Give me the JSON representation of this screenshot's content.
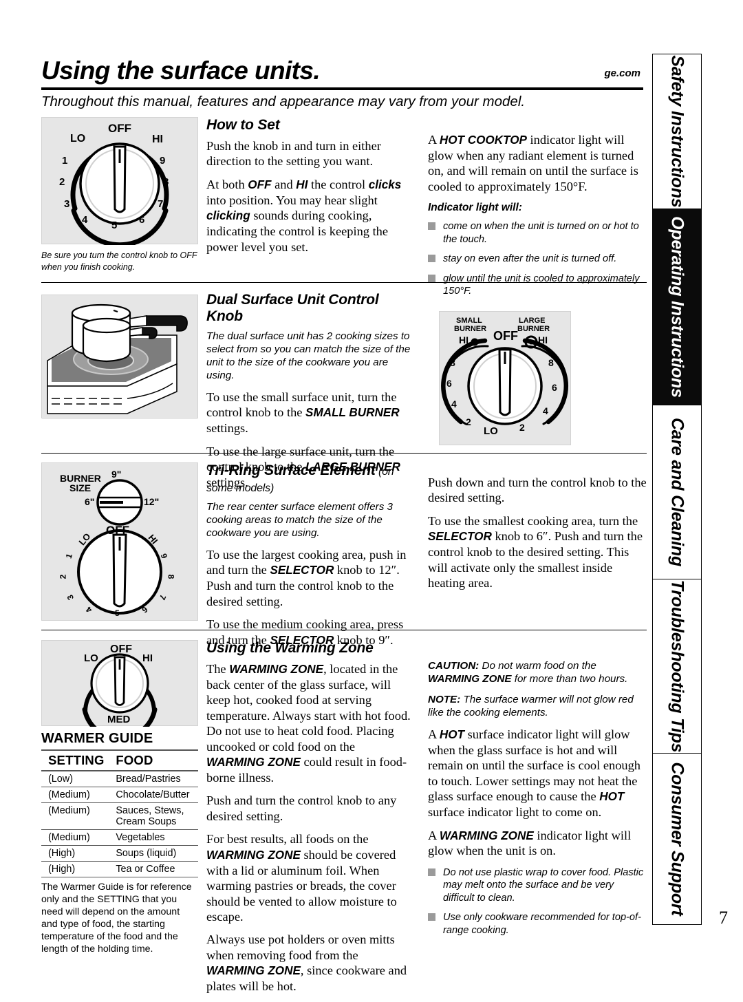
{
  "header": {
    "title": "Using the surface units.",
    "site": "ge.com",
    "subtitle": "Throughout this manual, features and appearance may vary from your model."
  },
  "sidebar": {
    "tabs": [
      {
        "label": "Safety Instructions",
        "active": false
      },
      {
        "label": "Operating Instructions",
        "active": true
      },
      {
        "label": "Care and Cleaning",
        "active": false
      },
      {
        "label": "Troubleshooting Tips",
        "active": false
      },
      {
        "label": "Consumer Support",
        "active": false
      }
    ]
  },
  "how_to_set": {
    "figure": {
      "off": "OFF",
      "lo": "LO",
      "hi": "HI",
      "numbers": [
        "1",
        "2",
        "3",
        "4",
        "5",
        "6",
        "7",
        "8",
        "9"
      ],
      "caption": "Be sure you turn the control knob to OFF when you finish cooking."
    },
    "heading": "How to Set",
    "p1": "Push the knob in and turn in either direction to the setting you want.",
    "p2_a": "At both ",
    "p2_off": "OFF",
    "p2_b": " and ",
    "p2_hi": "HI",
    "p2_c": " the control ",
    "p2_clicks": "clicks",
    "p2_d": " into position. You may hear slight ",
    "p2_clicking": "clicking",
    "p2_e": " sounds during cooking, indicating the control is keeping the power level you set.",
    "r1_a": "A ",
    "r1_hot": "HOT COOKTOP",
    "r1_b": " indicator light will glow when any radiant element is turned on, and will remain on until the surface is cooled to approximately 150°F.",
    "indicator_heading": "Indicator light will:",
    "bullets": [
      "come on when the unit is turned on or hot to the touch.",
      "stay on even after the unit is turned off.",
      "glow until the unit is cooled to approximately 150°F."
    ]
  },
  "dual_unit": {
    "heading": "Dual Surface Unit Control Knob",
    "p1": "The dual surface unit has 2 cooking sizes to select from so you can match the size of the unit to the size of the cookware you are using.",
    "p2_a": "To use the small surface unit, turn the control knob to the  ",
    "p2_small": "SMALL BURNER",
    "p2_b": " settings.",
    "p3_a": "To use the large surface unit, turn the control knob to the  ",
    "p3_large": "LARGE BURNER",
    "p3_b": " settings.",
    "figure": {
      "small_burner": "SMALL\nBURNER",
      "small_burner_l1": "SMALL",
      "small_burner_l2": "BURNER",
      "large_burner_l1": "LARGE",
      "large_burner_l2": "BURNER",
      "off": "OFF",
      "lo": "LO",
      "hi_left": "HI",
      "hi_right": "HI",
      "left_numbers": [
        "8",
        "6",
        "4",
        "2"
      ],
      "right_numbers": [
        "8",
        "6",
        "4",
        "2"
      ]
    }
  },
  "tri_ring": {
    "heading": "Tri-Ring Surface Element",
    "heading_note": "(on some models)",
    "p1": "The rear center surface element offers 3 cooking areas to match the size of the cookware you are using.",
    "p2_a": "To use the largest cooking area, push in and turn the ",
    "p2_sel": "SELECTOR",
    "p2_b": " knob to 12″. Push and turn the control knob to the desired setting.",
    "p3_a": "To use the medium cooking area, press and turn the ",
    "p3_sel": "SELECTOR",
    "p3_b": " knob to 9″.",
    "r1": "Push down and turn the control knob to the desired setting.",
    "r2_a": "To use the smallest cooking area, turn the ",
    "r2_sel": "SELECTOR",
    "r2_b": " knob to 6″. Push and turn the control knob to the desired setting. This will activate only the smallest inside heating area.",
    "figure": {
      "burner_size_l1": "BURNER",
      "burner_size_l2": "SIZE",
      "size_9": "9\"",
      "size_6": "6\"",
      "size_12": "12\"",
      "off": "OFF",
      "lo": "LO",
      "hi": "HI",
      "numbers": [
        "1",
        "2",
        "3",
        "4",
        "5",
        "6",
        "7",
        "8",
        "9"
      ]
    }
  },
  "warming_zone": {
    "heading": "Using the Warming Zone",
    "p1_a": "The ",
    "p1_wz": "WARMING ZONE",
    "p1_b": ", located in the back center of the glass surface, will keep hot, cooked food at serving temperature. Always start with hot food. Do not use to heat cold food. Placing uncooked or cold food on the ",
    "p1_wz2": "WARMING ZONE",
    "p1_c": " could result in food-borne illness.",
    "p2": "Push and turn the control knob to any desired setting.",
    "p3_a": "For best results, all foods on the ",
    "p3_wz": "WARMING ZONE",
    "p3_b": " should be covered with a lid or aluminum foil. When warming pastries or breads, the cover should be vented to allow moisture to escape.",
    "p4_a": "Always use pot holders or oven mitts when removing food from the ",
    "p4_wz": "WARMING ZONE",
    "p4_b": ", since cookware and plates will be hot.",
    "caution_label": "CAUTION:",
    "caution_a": " Do not warm food on the ",
    "caution_wz": "WARMING ZONE",
    "caution_b": " for more than two hours.",
    "note_label": "NOTE:",
    "note_text": " The surface warmer will not glow red like the cooking elements.",
    "r2_a": "A ",
    "r2_hot": "HOT",
    "r2_b": " surface indicator light will glow when the glass surface is hot and will remain on until the surface is cool enough to touch. Lower settings may not heat the glass surface enough to cause the ",
    "r2_hot2": "HOT",
    "r2_c": " surface indicator light to come on.",
    "r3_a": "A ",
    "r3_wz": "WARMING ZONE",
    "r3_b": " indicator light will glow when the unit is on.",
    "bullets": [
      "Do not use plastic wrap to cover food. Plastic may melt onto the surface and be very difficult to clean.",
      "Use only cookware recommended for top-of-range cooking."
    ],
    "figure": {
      "off": "OFF",
      "lo": "LO",
      "hi": "HI",
      "med": "MED"
    }
  },
  "warmer_guide": {
    "title": "WARMER GUIDE",
    "columns": [
      "SETTING",
      "FOOD"
    ],
    "rows": [
      {
        "setting": "(Low)",
        "food": "Bread/Pastries"
      },
      {
        "setting": "(Medium)",
        "food": "Chocolate/Butter"
      },
      {
        "setting": "(Medium)",
        "food": "Sauces, Stews,\nCream Soups"
      },
      {
        "setting": "(Medium)",
        "food": "Vegetables"
      },
      {
        "setting": "(High)",
        "food": "Soups (liquid)"
      },
      {
        "setting": "(High)",
        "food": "Tea or Coffee"
      }
    ],
    "note": "The Warmer Guide is for reference only and the SETTING that you need will depend on the amount and type of food, the starting temperature of the food and the length of the holding time."
  },
  "page_number": "7",
  "colors": {
    "figure_bg": "#e6e6e6",
    "bullet": "#9a9a9a",
    "ink": "#000000",
    "active_tab": "#0b0b0b"
  }
}
